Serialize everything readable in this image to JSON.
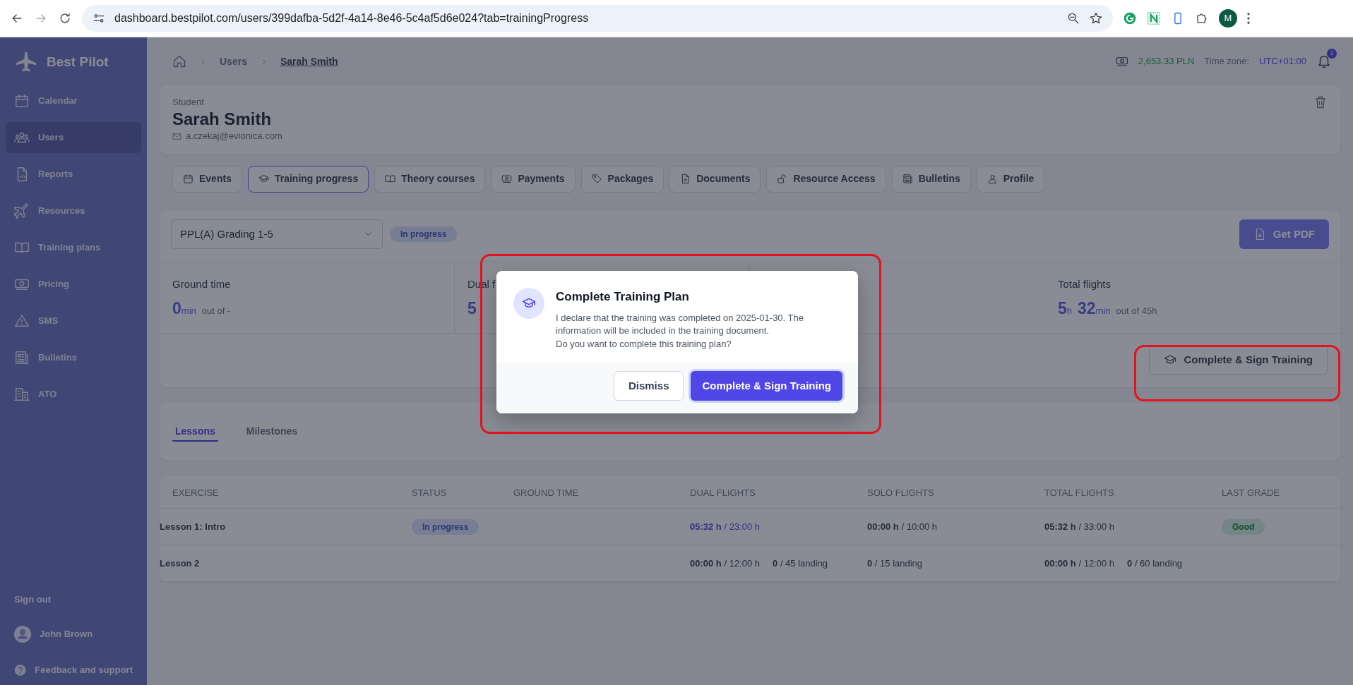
{
  "browser": {
    "url": "dashboard.bestpilot.com/users/399dafba-5d2f-4a14-8e46-5c4af5d6e024?tab=trainingProgress",
    "profile_initial": "M"
  },
  "sidebar": {
    "brand": "Best Pilot",
    "items": [
      {
        "label": "Calendar",
        "selected": false
      },
      {
        "label": "Users",
        "selected": true
      },
      {
        "label": "Reports",
        "selected": false
      },
      {
        "label": "Resources",
        "selected": false
      },
      {
        "label": "Training plans",
        "selected": false
      },
      {
        "label": "Pricing",
        "selected": false
      },
      {
        "label": "SMS",
        "selected": false
      },
      {
        "label": "Bulletins",
        "selected": false
      },
      {
        "label": "ATO",
        "selected": false
      }
    ],
    "sign_out": "Sign out",
    "user": "John Brown",
    "feedback": "Feedback and support"
  },
  "breadcrumb": [
    "Users",
    "Sarah Smith"
  ],
  "topbar": {
    "balance": "2,653.33 PLN",
    "timezone_label": "Time zone:",
    "timezone": "UTC+01:00",
    "notifications": "1"
  },
  "student": {
    "role": "Student",
    "name": "Sarah Smith",
    "email": "a.czekaj@evionica.com"
  },
  "tabs": [
    {
      "label": "Events",
      "selected": false
    },
    {
      "label": "Training progress",
      "selected": true
    },
    {
      "label": "Theory courses",
      "selected": false
    },
    {
      "label": "Payments",
      "selected": false
    },
    {
      "label": "Packages",
      "selected": false
    },
    {
      "label": "Documents",
      "selected": false
    },
    {
      "label": "Resource Access",
      "selected": false
    },
    {
      "label": "Bulletins",
      "selected": false
    },
    {
      "label": "Profile",
      "selected": false
    }
  ],
  "plan": {
    "select": "PPL(A) Grading 1-5",
    "status": "In progress",
    "pdf_button": "Get PDF"
  },
  "stats": [
    {
      "label": "Ground time",
      "parts": [
        {
          "num": "0",
          "unit": "min"
        }
      ],
      "suffix": "out of -"
    },
    {
      "label": "Dual f",
      "parts": [
        {
          "num": "5"
        }
      ]
    },
    {
      "label": "Total flights",
      "parts": [
        {
          "num": "5",
          "unit": "h"
        },
        {
          "num": "32",
          "unit": "min"
        }
      ],
      "suffix": "out of 45h"
    }
  ],
  "complete_button": "Complete & Sign Training",
  "lesson_tabs": [
    {
      "label": "Lessons",
      "selected": true
    },
    {
      "label": "Milestones",
      "selected": false
    }
  ],
  "table": {
    "columns": [
      "EXERCISE",
      "STATUS",
      "GROUND TIME",
      "DUAL FLIGHTS",
      "SOLO FLIGHTS",
      "TOTAL FLIGHTS",
      "LAST GRADE"
    ],
    "rows": [
      {
        "exercise": "Lesson 1: Intro",
        "status": "In progress",
        "dual": {
          "accent": true,
          "items": [
            {
              "strong": "05:32 h",
              "rest": "/ 23:00 h"
            }
          ]
        },
        "solo": {
          "accent": false,
          "items": [
            {
              "strong": "00:00 h",
              "rest": "/ 10:00 h"
            }
          ]
        },
        "total": {
          "accent": false,
          "items": [
            {
              "strong": "05:32 h",
              "rest": "/ 33:00 h"
            }
          ]
        },
        "grade": "Good"
      },
      {
        "exercise": "Lesson 2",
        "dual": {
          "accent": false,
          "items": [
            {
              "strong": "00:00 h",
              "rest": "/ 12:00 h"
            },
            {
              "strong": "0",
              "rest": "/ 45 landing"
            }
          ]
        },
        "solo": {
          "accent": false,
          "items": [
            {
              "strong": "0",
              "rest": "/ 15 landing"
            }
          ]
        },
        "total": {
          "accent": false,
          "items": [
            {
              "strong": "00:00 h",
              "rest": "/ 12:00 h"
            },
            {
              "strong": "0",
              "rest": "/ 60 landing"
            }
          ]
        }
      }
    ]
  },
  "modal": {
    "title": "Complete Training Plan",
    "lines": [
      "I declare that the training was completed on 2025-01-30. The information will be included in the training document.",
      "Do you want to complete this training plan?"
    ],
    "dismiss": "Dismiss",
    "confirm": "Complete & Sign Training"
  }
}
